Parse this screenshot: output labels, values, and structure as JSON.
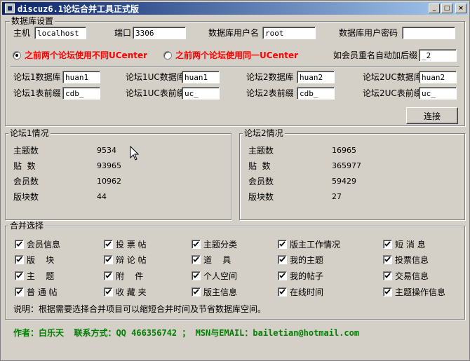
{
  "window": {
    "title": "discuz6.1论坛合并工具正式版"
  },
  "db": {
    "legend": "数据库设置",
    "host_label": "主机",
    "host_value": "localhost",
    "port_label": "端口",
    "port_value": "3306",
    "user_label": "数据库用户名",
    "user_value": "root",
    "pass_label": "数据库用户密码",
    "pass_value": "",
    "radio1_label": "之前两个论坛使用不同UCenter",
    "radio2_label": "之前两个论坛使用同一UCenter",
    "suffix_label": "如会员重名自动加后缀",
    "suffix_value": "_2",
    "f1db_label": "论坛1数据库",
    "f1db_value": "huan1",
    "f1ucdb_label": "论坛1UC数据库",
    "f1ucdb_value": "huan1",
    "f2db_label": "论坛2数据库",
    "f2db_value": "huan2",
    "f2ucdb_label": "论坛2UC数据库",
    "f2ucdb_value": "huan2",
    "f1pre_label": "论坛1表前缀",
    "f1pre_value": "cdb_",
    "f1ucpre_label": "论坛1UC表前缀",
    "f1ucpre_value": "uc_",
    "f2pre_label": "论坛2表前缀",
    "f2pre_value": "cdb_",
    "f2ucpre_label": "论坛2UC表前缀",
    "f2ucpre_value": "uc_",
    "connect_label": "连接"
  },
  "forum1": {
    "legend": "论坛1情况",
    "threads_label": "主题数",
    "threads": "9534",
    "posts_label": "贴  数",
    "posts": "93965",
    "members_label": "会员数",
    "members": "10962",
    "boards_label": "版块数",
    "boards": "44"
  },
  "forum2": {
    "legend": "论坛2情况",
    "threads_label": "主题数",
    "threads": "16965",
    "posts_label": "贴  数",
    "posts": "365977",
    "members_label": "会员数",
    "members": "59429",
    "boards_label": "版块数",
    "boards": "27"
  },
  "merge": {
    "legend": "合并选择",
    "items": [
      "会员信息",
      "投 票 帖",
      "主题分类",
      "版主工作情况",
      "短 消 息",
      "版    块",
      "辩 论 帖",
      "道    具",
      "我的主题",
      "投票信息",
      "主    题",
      "附    件",
      "个人空间",
      "我的帖子",
      "交易信息",
      "普 通 帖",
      "收 藏 夹",
      "版主信息",
      "在线时间",
      "主题操作信息"
    ],
    "note": "说明：根据需要选择合并项目可以缩短合并时间及节省数据库空间。"
  },
  "footer": {
    "credits": "作者：白乐天  联系方式：QQ 466356742 ； MSN与EMAIL：bailetian@hotmail.com"
  },
  "colors": {
    "accent_red": "#ff0000",
    "credits_green": "#008000",
    "titlebar": "#0a246a"
  }
}
